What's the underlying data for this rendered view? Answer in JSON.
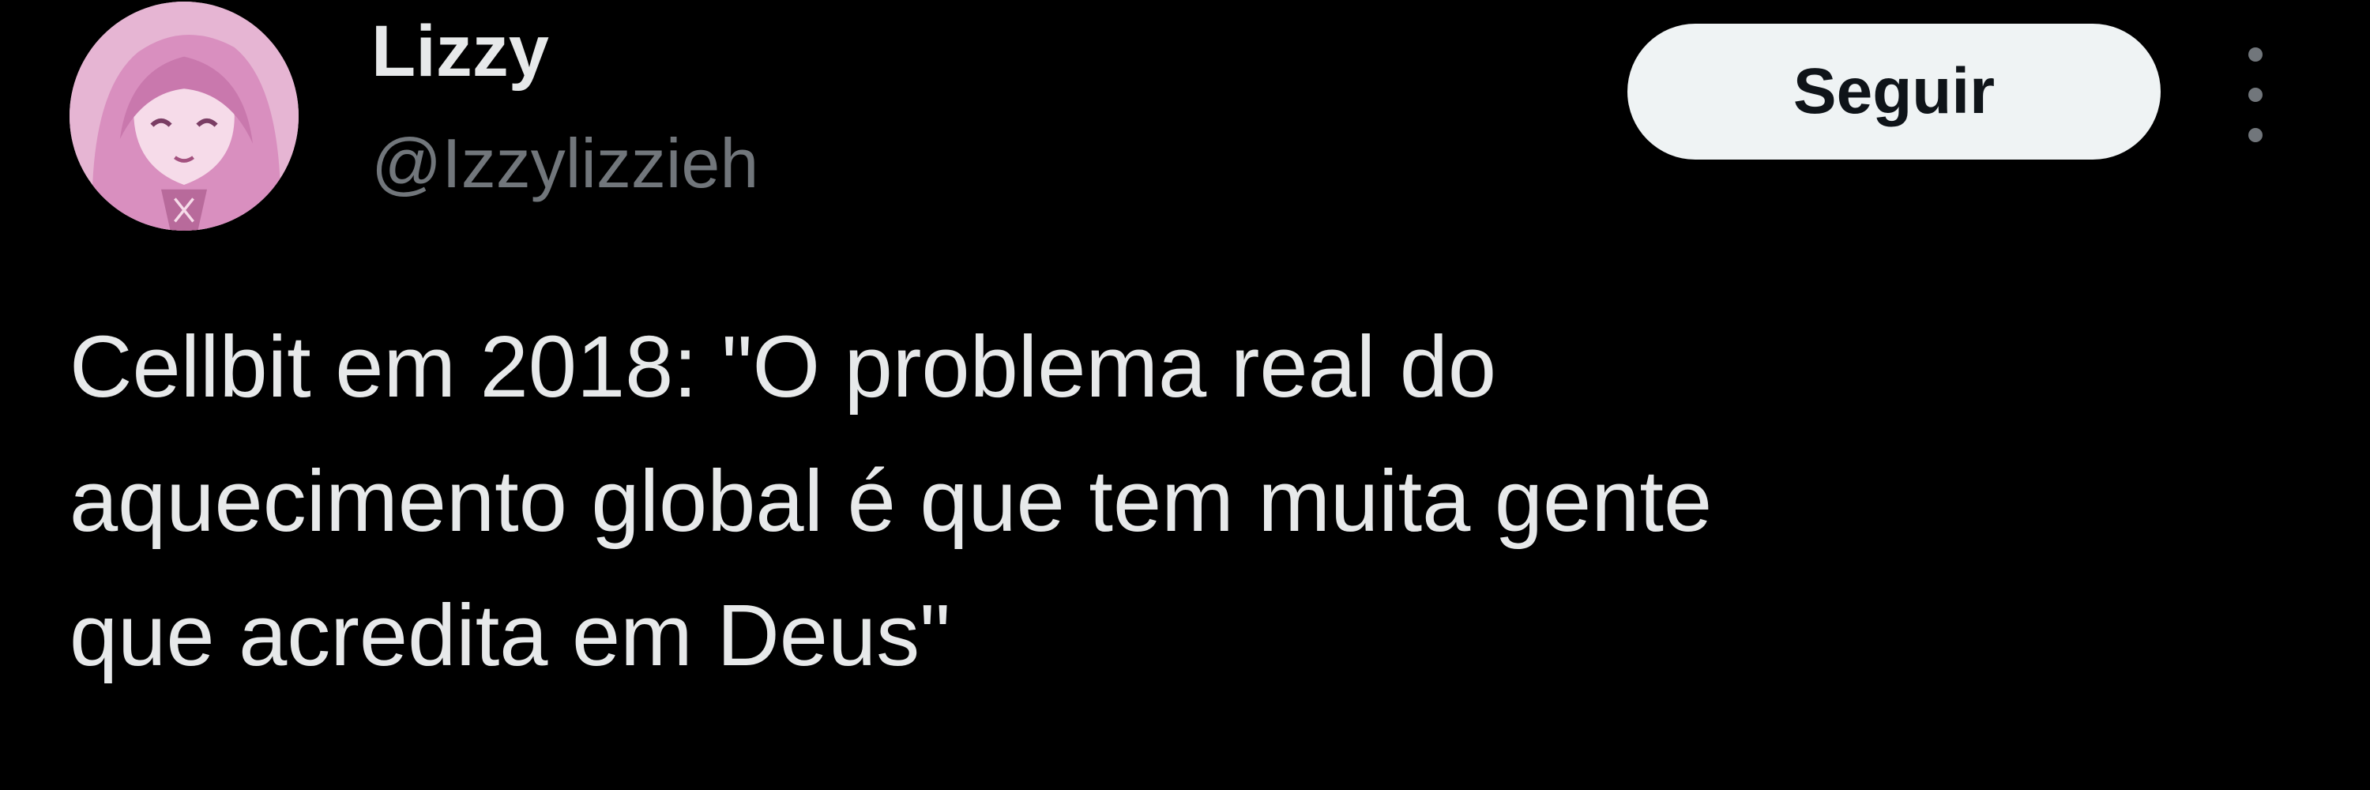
{
  "tweet": {
    "author": {
      "display_name": "Lizzy",
      "handle": "@Izzylizzieh",
      "avatar_icon": "anime-pink-hair-avatar"
    },
    "follow_label": "Seguir",
    "more_icon": "more-vertical-icon",
    "text": "Cellbit em 2018: \"O problema real do\naquecimento global é que tem muita gente\nque acredita em Deus\""
  },
  "colors": {
    "background": "#000000",
    "primary_text": "#e7e9ea",
    "secondary_text": "#71767b",
    "button_background": "#eff3f4",
    "button_text": "#0f1419",
    "avatar_tint": "#e8b9d6"
  }
}
